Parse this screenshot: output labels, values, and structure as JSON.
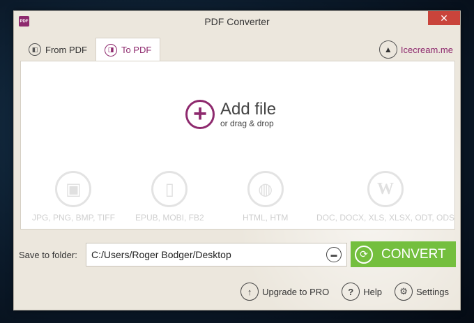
{
  "window": {
    "title": "PDF Converter",
    "app_icon_text": "PDF",
    "close_glyph": "✕"
  },
  "tabs": [
    {
      "label": "From PDF",
      "icon": "pdf-out-icon",
      "glyph": "◧",
      "active": false
    },
    {
      "label": "To PDF",
      "icon": "pdf-in-icon",
      "glyph": "◨",
      "active": true
    }
  ],
  "brand": {
    "label": "Icecream.me",
    "icon": "icecream-icon",
    "glyph": "▲"
  },
  "drop_zone": {
    "title": "Add file",
    "subtitle": "or drag & drop",
    "plus_glyph": "+"
  },
  "formats": [
    {
      "label": "JPG, PNG, BMP, TIFF",
      "icon": "camera-icon",
      "glyph": "▣"
    },
    {
      "label": "EPUB, MOBI, FB2",
      "icon": "phone-icon",
      "glyph": "▯"
    },
    {
      "label": "HTML, HTM",
      "icon": "globe-icon",
      "glyph": "◍"
    },
    {
      "label": "DOC, DOCX, XLS, XLSX, ODT, ODS",
      "icon": "word-icon",
      "glyph": "W"
    }
  ],
  "save": {
    "label": "Save to folder:",
    "path": "C:/Users/Roger Bodger/Desktop",
    "browse_icon": "folder-icon",
    "browse_glyph": "▬"
  },
  "convert": {
    "label": "CONVERT",
    "icon": "refresh-icon",
    "glyph": "⟳"
  },
  "footer": {
    "upgrade": {
      "label": "Upgrade to PRO",
      "icon": "arrow-up-icon",
      "glyph": "↑"
    },
    "help": {
      "label": "Help",
      "icon": "question-icon",
      "glyph": "?"
    },
    "settings": {
      "label": "Settings",
      "icon": "gear-icon",
      "glyph": "⚙"
    }
  },
  "colors": {
    "accent": "#8e2a6e",
    "convert_green": "#74bf3e",
    "close_red": "#c9443b"
  }
}
